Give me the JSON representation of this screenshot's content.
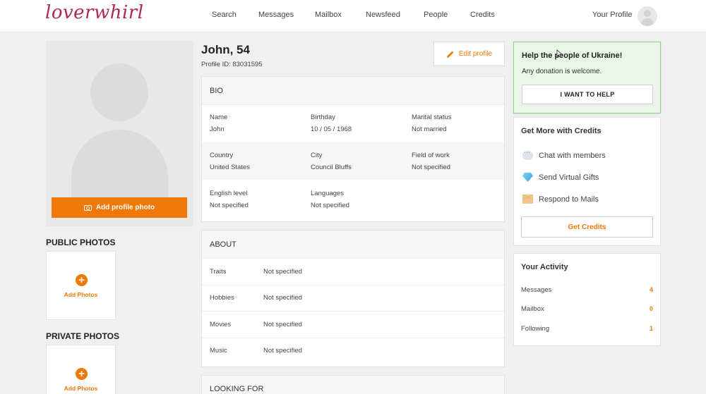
{
  "header": {
    "logo": "loverwhirl",
    "nav": [
      "Search",
      "Messages",
      "Mailbox",
      "Newsfeed",
      "People",
      "Credits"
    ],
    "profile_label": "Your Profile"
  },
  "left": {
    "add_photo_label": "Add profile photo",
    "public_title": "PUBLIC PHOTOS",
    "private_title": "PRIVATE PHOTOS",
    "add_photos_label": "Add Photos"
  },
  "profile": {
    "name": "John, 54",
    "profile_id": "Profile ID: 83031595",
    "edit_label": "Edit profile"
  },
  "bio": {
    "title": "BIO",
    "rows": [
      [
        {
          "label": "Name",
          "value": "John"
        },
        {
          "label": "Birthday",
          "value": "10 / 05 / 1968"
        },
        {
          "label": "Marital status",
          "value": "Not married"
        }
      ],
      [
        {
          "label": "Country",
          "value": "United States"
        },
        {
          "label": "City",
          "value": "Council Bluffs"
        },
        {
          "label": "Field of work",
          "value": "Not specified"
        }
      ],
      [
        {
          "label": "English level",
          "value": "Not specified"
        },
        {
          "label": "Languages",
          "value": "Not specified"
        }
      ]
    ]
  },
  "about": {
    "title": "ABOUT",
    "rows": [
      {
        "label": "Traits",
        "value": "Not specified"
      },
      {
        "label": "Hobbies",
        "value": "Not specified"
      },
      {
        "label": "Movies",
        "value": "Not specified"
      },
      {
        "label": "Music",
        "value": "Not specified"
      }
    ]
  },
  "looking_for": {
    "title": "LOOKING FOR"
  },
  "ukraine": {
    "title": "Help the people of Ukraine!",
    "subtitle": "Any donation is welcome.",
    "button": "I WANT TO HELP"
  },
  "credits": {
    "title": "Get More with Credits",
    "items": [
      {
        "icon": "chat-bubble-icon",
        "label": "Chat with members"
      },
      {
        "icon": "diamond-icon",
        "label": "Send Virtual Gifts"
      },
      {
        "icon": "envelope-icon",
        "label": "Respond to Mails"
      }
    ],
    "button": "Get Credits"
  },
  "activity": {
    "title": "Your Activity",
    "rows": [
      {
        "label": "Messages",
        "value": "4"
      },
      {
        "label": "Mailbox",
        "value": "0"
      },
      {
        "label": "Following",
        "value": "1"
      }
    ]
  },
  "colors": {
    "accent": "#ef7808",
    "logo": "#b02a4a",
    "ukraine_bg": "#eaf6e8",
    "ukraine_border": "#8fd18b"
  }
}
